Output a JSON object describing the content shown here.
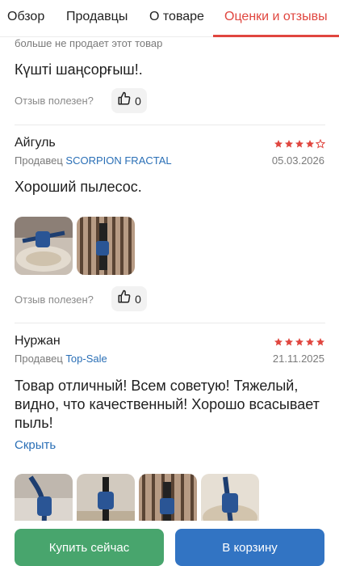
{
  "tabs": [
    {
      "label": "Обзор"
    },
    {
      "label": "Продавцы"
    },
    {
      "label": "О товаре"
    },
    {
      "label": "Оценки и отзывы",
      "active": true
    }
  ],
  "colors": {
    "accent": "#e0463f",
    "link": "#2a6fb6",
    "star": "#e0463f",
    "buy": "#48a56d",
    "cart": "#3274c3"
  },
  "reviews": [
    {
      "cut_text": "больше не продает этот товар",
      "text": "Күшті шаңсорғыш!.",
      "helpful_label": "Отзыв полезен?",
      "likes": "0"
    },
    {
      "author": "Айгуль",
      "rating": 4,
      "seller_prefix": "Продавец",
      "seller_name": "SCORPION FRACTAL",
      "date": "05.03.2026",
      "text": "Хороший пылесос.",
      "photos": 2,
      "helpful_label": "Отзыв полезен?",
      "likes": "0"
    },
    {
      "author": "Нуржан",
      "rating": 5,
      "seller_prefix": "Продавец",
      "seller_name": "Top-Sale",
      "date": "21.11.2025",
      "text": "Товар отличный! Всем советую! Тяжелый, видно, что качественный! Хорошо всасывает пыль!",
      "collapse_label": "Скрыть",
      "photos": 4
    }
  ],
  "actions": {
    "buy_label": "Купить сейчас",
    "cart_label": "В корзину"
  }
}
